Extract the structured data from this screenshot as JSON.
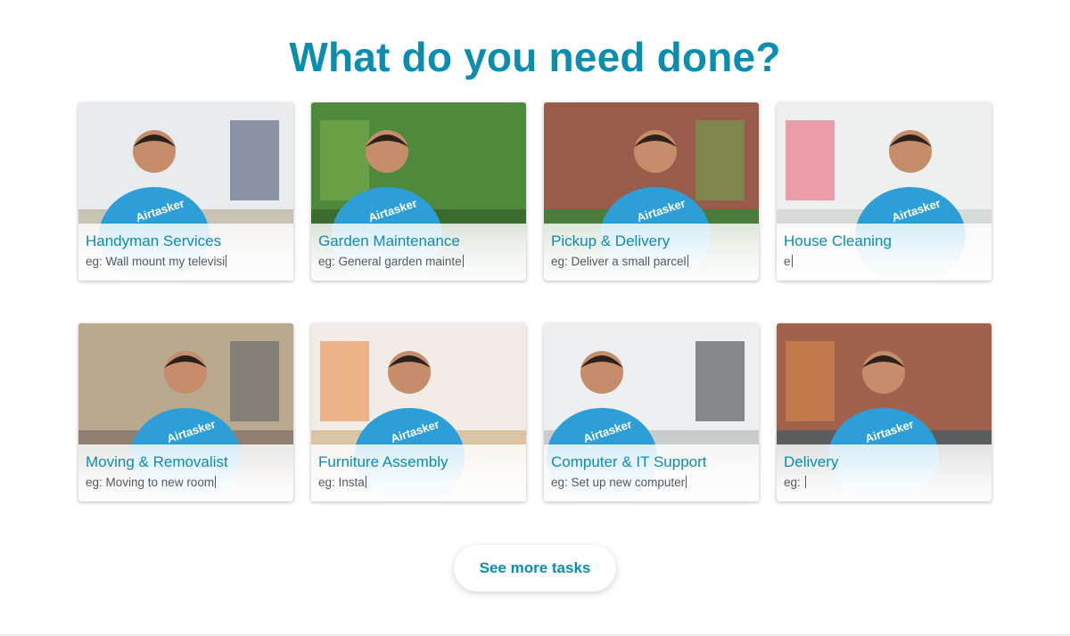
{
  "page": {
    "title": "What do you need done?"
  },
  "tasks": [
    {
      "name": "Handyman Services",
      "example": "eg: Wall mount my televisi",
      "scene": "handyman-photo",
      "wall": "#e8ecee",
      "floor": "#c8c2b5",
      "accent": "#3b4a66"
    },
    {
      "name": "Garden Maintenance",
      "example": "eg: General garden mainte",
      "scene": "garden-photo",
      "wall": "#4f8a3c",
      "floor": "#3c6b2f",
      "accent": "#7fb24d"
    },
    {
      "name": "Pickup & Delivery",
      "example": "eg: Deliver a small parcel",
      "scene": "delivery-photo",
      "wall": "#9a5c4a",
      "floor": "#4b7d3a",
      "accent": "#6aa74a"
    },
    {
      "name": "House Cleaning",
      "example": "e",
      "scene": "cleaning-photo",
      "wall": "#eef0ef",
      "floor": "#d8dad7",
      "accent": "#e85a6e"
    },
    {
      "name": "Moving & Removalist",
      "example": "eg: Moving to new room",
      "scene": "moving-photo",
      "wall": "#b9a98e",
      "floor": "#8f8272",
      "accent": "#5b5f63"
    },
    {
      "name": "Furniture Assembly",
      "example": "eg: Insta",
      "scene": "furniture-photo",
      "wall": "#f1ede6",
      "floor": "#d9c4a4",
      "accent": "#e4833a"
    },
    {
      "name": "Computer & IT Support",
      "example": "eg: Set up new computer",
      "scene": "computer-photo",
      "wall": "#eceeef",
      "floor": "#c9cccd",
      "accent": "#2f3337"
    },
    {
      "name": "Delivery",
      "example": "eg: ",
      "scene": "street-photo",
      "wall": "#a0624d",
      "floor": "#5a5e60",
      "accent": "#e08a4a"
    }
  ],
  "brand": {
    "shirt_color": "#2c9fd9",
    "shirt_text": "Airtasker",
    "accent": "#0b8db0"
  },
  "actions": {
    "see_more": "See more tasks"
  }
}
